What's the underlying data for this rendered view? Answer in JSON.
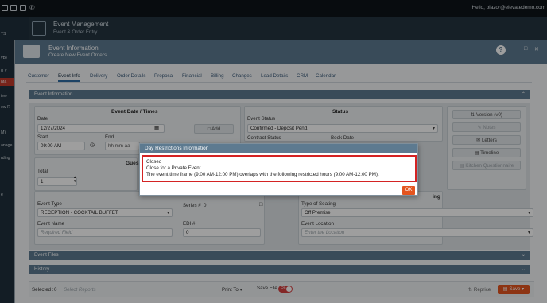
{
  "topbar": {
    "user": "Hello, blazor@elevatedemo.com"
  },
  "sidebar": {
    "items": [
      "TS",
      "vB)",
      "g ∨",
      "Ma",
      "iew",
      "ew R",
      "M)",
      "anage",
      "rding",
      "e"
    ]
  },
  "app": {
    "title": "Event Management",
    "subtitle": "Event & Order Entry"
  },
  "modal": {
    "title": "Event Information",
    "subtitle": "Create New Event Orders",
    "help": "?",
    "controls": [
      "–",
      "□",
      "✕"
    ]
  },
  "tabs": [
    "Customer",
    "Event Info",
    "Delivery",
    "Order Details",
    "Proposal",
    "Financial",
    "Billing",
    "Changes",
    "Lead Details",
    "CRM",
    "Calendar"
  ],
  "active_tab": "Event Info",
  "section_event_info": "Event Information",
  "event_date": {
    "header": "Event Date / Times",
    "date_label": "Date",
    "date_value": "12/27/2024",
    "add_button": "Add",
    "start_label": "Start",
    "start_value": "09:00 AM",
    "end_label": "End",
    "end_value": "hh:mm aa"
  },
  "guests": {
    "header": "Gues",
    "total_label": "Total",
    "total_value": "1"
  },
  "status": {
    "header": "Status",
    "event_status_label": "Event Status",
    "event_status_value": "Confirmed - Deposit Pend.",
    "contract_status_label": "Contract Status",
    "book_date_label": "Book Date"
  },
  "side_buttons": [
    "Version (v0)",
    "Notes",
    "Letters",
    "Timeline",
    "Kitchen Questionnaire"
  ],
  "event_type": {
    "label": "Event Type",
    "value": "RECEPTION - COCKTAIL BUFFET",
    "series_label": "Series #",
    "series_value": "0",
    "name_label": "Event Name",
    "name_placeholder": "Required Field",
    "edi_label": "EDI #",
    "edi_value": "0"
  },
  "seating": {
    "header_fragment": "ing",
    "type_label": "Type of Seating",
    "type_value": "Off Premise",
    "location_label": "Event Location",
    "location_placeholder": "Enter the Location"
  },
  "section_event_files": "Event Files",
  "section_history": "History",
  "bottombar": {
    "selected_label": "Selected :",
    "selected_count": "0",
    "select_reports_placeholder": "Select Reports",
    "print_to": "Print To",
    "save_file": "Save File",
    "save_file_toggle": "On",
    "reprice": "Reprice",
    "save": "Save"
  },
  "dialog": {
    "title": "Day Restrictions Information",
    "lines": [
      "Closed",
      "Close for a Private Event",
      "The event time frame (9:00 AM-12:00 PM) overlaps with the following restricted hours (9:00 AM-12:00 PM)."
    ],
    "ok": "OK"
  },
  "colors": {
    "header_blue": "#5d7a90",
    "accent_orange": "#e4551f",
    "alert_red": "#d42323"
  }
}
